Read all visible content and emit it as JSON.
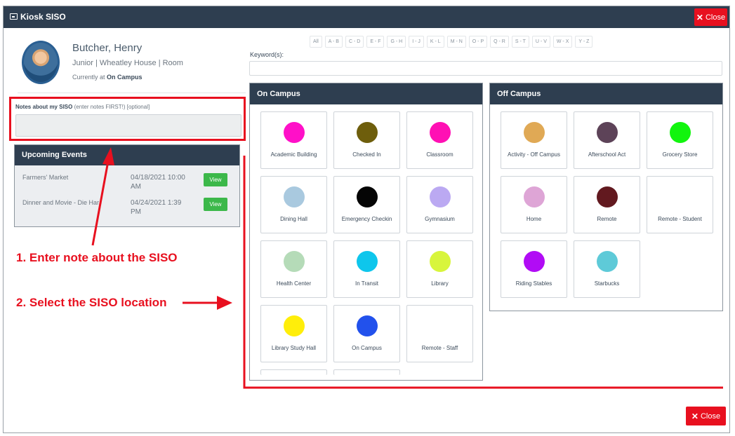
{
  "window": {
    "title": "Kiosk SISO",
    "close_label": "Close"
  },
  "profile": {
    "name": "Butcher, Henry",
    "meta": "Junior | Wheatley House | Room",
    "location_prefix": "Currently at",
    "location": "On Campus"
  },
  "notes": {
    "label": "Notes about my SISO",
    "hint": "(enter notes FIRST!) [optional]",
    "value": ""
  },
  "events": {
    "title": "Upcoming Events",
    "items": [
      {
        "name": "Farmers' Market",
        "date": "04/18/2021 10:00 AM",
        "button": "View"
      },
      {
        "name": "Dinner and Movie - Die Har",
        "date": "04/24/2021 1:39 PM",
        "button": "View"
      }
    ]
  },
  "annotations": {
    "step1": "1. Enter note about the SISO",
    "step2": "2. Select the SISO location",
    "color": "#e8101f"
  },
  "filters": [
    "All",
    "A - B",
    "C - D",
    "E - F",
    "G - H",
    "I - J",
    "K - L",
    "M - N",
    "O - P",
    "Q - R",
    "S - T",
    "U - V",
    "W - X",
    "Y - Z"
  ],
  "keyword": {
    "label": "Keyword(s):",
    "value": ""
  },
  "on_campus": {
    "title": "On Campus",
    "tiles": [
      {
        "label": "Academic Building",
        "color": "#ff10c8"
      },
      {
        "label": "Checked In",
        "color": "#6e5e0c"
      },
      {
        "label": "Classroom",
        "color": "#ff10b4"
      },
      {
        "label": "Dining Hall",
        "color": "#a9c9df"
      },
      {
        "label": "Emergency Checkin",
        "color": "#050505"
      },
      {
        "label": "Gymnasium",
        "color": "#bba9f2"
      },
      {
        "label": "Health Center",
        "color": "#b5dbb8"
      },
      {
        "label": "In Transit",
        "color": "#0ec6ec"
      },
      {
        "label": "Library",
        "color": "#d8f53c"
      },
      {
        "label": "Library Study Hall",
        "color": "#ffee0a"
      },
      {
        "label": "On Campus",
        "color": "#2251ec"
      },
      {
        "label": "Remote - Staff",
        "color": ""
      }
    ]
  },
  "off_campus": {
    "title": "Off Campus",
    "tiles": [
      {
        "label": "Activity - Off Campus",
        "color": "#e0a955"
      },
      {
        "label": "Afterschool Act",
        "color": "#5d4358"
      },
      {
        "label": "Grocery Store",
        "color": "#12f50e"
      },
      {
        "label": "Home",
        "color": "#dea5d6"
      },
      {
        "label": "Remote",
        "color": "#62191f"
      },
      {
        "label": "Remote - Student",
        "color": ""
      },
      {
        "label": "Riding Stables",
        "color": "#b10cf5"
      },
      {
        "label": "Starbucks",
        "color": "#5ecad8"
      }
    ]
  }
}
